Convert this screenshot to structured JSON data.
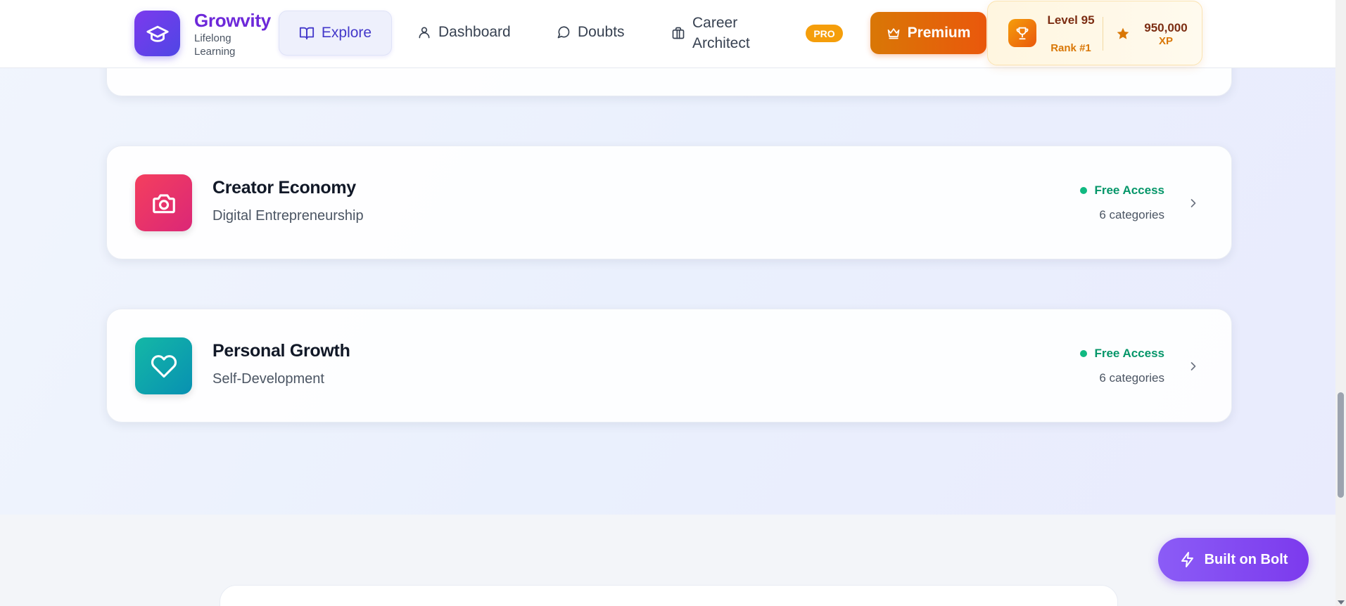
{
  "brand": {
    "name": "Growvity",
    "tagline": "Lifelong Learning"
  },
  "nav": {
    "explore": "Explore",
    "dashboard": "Dashboard",
    "doubts": "Doubts",
    "career": "Career Architect",
    "pro_badge": "PRO",
    "premium": "Premium"
  },
  "stats": {
    "level": "Level 95",
    "rank": "Rank #1",
    "xp_value": "950,000",
    "xp_label": "XP"
  },
  "cards": [
    {
      "title": "Creator Economy",
      "subtitle": "Digital Entrepreneurship",
      "access": "Free Access",
      "count": "6 categories",
      "icon": "camera-icon",
      "color": "#e11d48"
    },
    {
      "title": "Personal Growth",
      "subtitle": "Self-Development",
      "access": "Free Access",
      "count": "6 categories",
      "icon": "heart-icon",
      "color": "#0d9488"
    }
  ],
  "bolt_button": "Built on Bolt",
  "colors": {
    "brand": "#6d28d9",
    "premium": "#ea580c",
    "access": "#059669",
    "bolt": "#7c3aed"
  }
}
